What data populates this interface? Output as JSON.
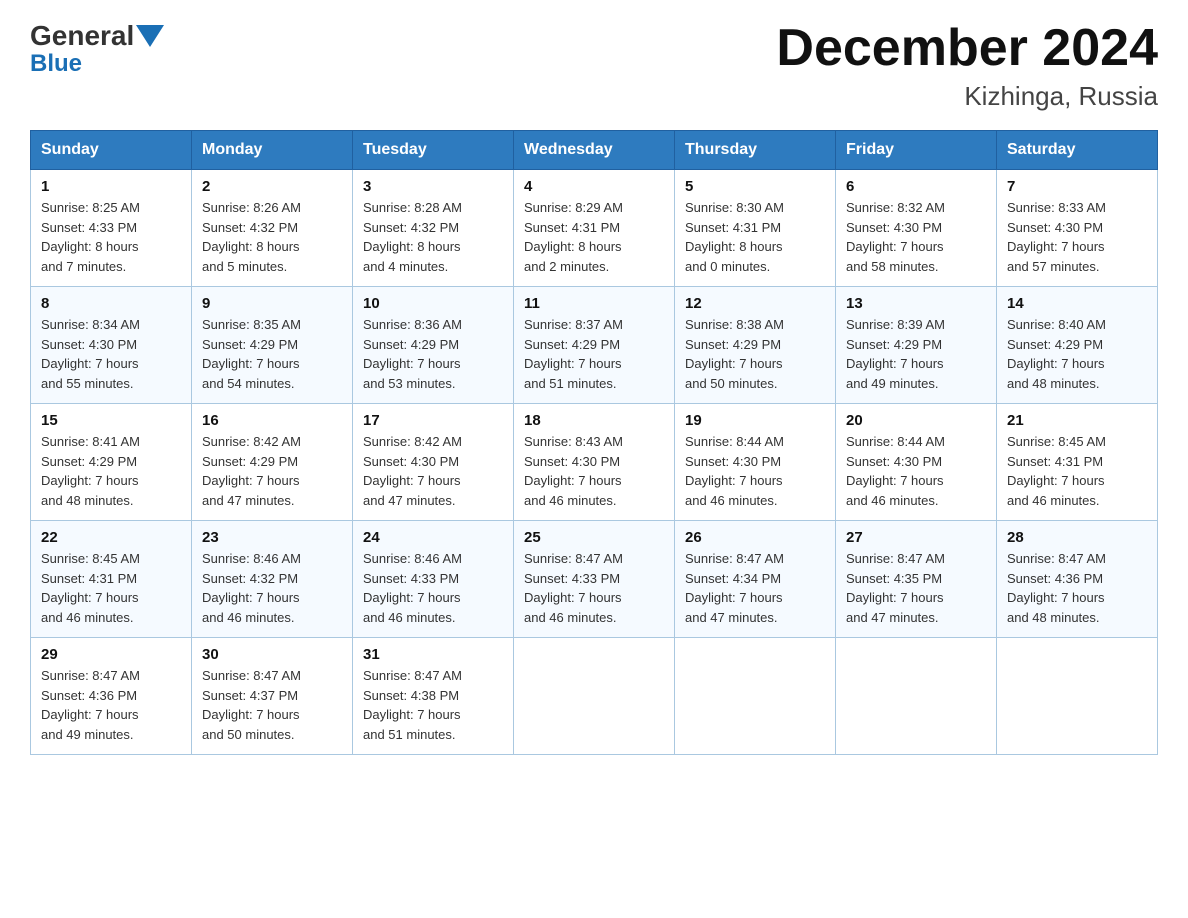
{
  "header": {
    "logo_general": "General",
    "logo_blue": "Blue",
    "title": "December 2024",
    "subtitle": "Kizhinga, Russia"
  },
  "weekdays": [
    "Sunday",
    "Monday",
    "Tuesday",
    "Wednesday",
    "Thursday",
    "Friday",
    "Saturday"
  ],
  "weeks": [
    [
      {
        "day": "1",
        "info": "Sunrise: 8:25 AM\nSunset: 4:33 PM\nDaylight: 8 hours\nand 7 minutes."
      },
      {
        "day": "2",
        "info": "Sunrise: 8:26 AM\nSunset: 4:32 PM\nDaylight: 8 hours\nand 5 minutes."
      },
      {
        "day": "3",
        "info": "Sunrise: 8:28 AM\nSunset: 4:32 PM\nDaylight: 8 hours\nand 4 minutes."
      },
      {
        "day": "4",
        "info": "Sunrise: 8:29 AM\nSunset: 4:31 PM\nDaylight: 8 hours\nand 2 minutes."
      },
      {
        "day": "5",
        "info": "Sunrise: 8:30 AM\nSunset: 4:31 PM\nDaylight: 8 hours\nand 0 minutes."
      },
      {
        "day": "6",
        "info": "Sunrise: 8:32 AM\nSunset: 4:30 PM\nDaylight: 7 hours\nand 58 minutes."
      },
      {
        "day": "7",
        "info": "Sunrise: 8:33 AM\nSunset: 4:30 PM\nDaylight: 7 hours\nand 57 minutes."
      }
    ],
    [
      {
        "day": "8",
        "info": "Sunrise: 8:34 AM\nSunset: 4:30 PM\nDaylight: 7 hours\nand 55 minutes."
      },
      {
        "day": "9",
        "info": "Sunrise: 8:35 AM\nSunset: 4:29 PM\nDaylight: 7 hours\nand 54 minutes."
      },
      {
        "day": "10",
        "info": "Sunrise: 8:36 AM\nSunset: 4:29 PM\nDaylight: 7 hours\nand 53 minutes."
      },
      {
        "day": "11",
        "info": "Sunrise: 8:37 AM\nSunset: 4:29 PM\nDaylight: 7 hours\nand 51 minutes."
      },
      {
        "day": "12",
        "info": "Sunrise: 8:38 AM\nSunset: 4:29 PM\nDaylight: 7 hours\nand 50 minutes."
      },
      {
        "day": "13",
        "info": "Sunrise: 8:39 AM\nSunset: 4:29 PM\nDaylight: 7 hours\nand 49 minutes."
      },
      {
        "day": "14",
        "info": "Sunrise: 8:40 AM\nSunset: 4:29 PM\nDaylight: 7 hours\nand 48 minutes."
      }
    ],
    [
      {
        "day": "15",
        "info": "Sunrise: 8:41 AM\nSunset: 4:29 PM\nDaylight: 7 hours\nand 48 minutes."
      },
      {
        "day": "16",
        "info": "Sunrise: 8:42 AM\nSunset: 4:29 PM\nDaylight: 7 hours\nand 47 minutes."
      },
      {
        "day": "17",
        "info": "Sunrise: 8:42 AM\nSunset: 4:30 PM\nDaylight: 7 hours\nand 47 minutes."
      },
      {
        "day": "18",
        "info": "Sunrise: 8:43 AM\nSunset: 4:30 PM\nDaylight: 7 hours\nand 46 minutes."
      },
      {
        "day": "19",
        "info": "Sunrise: 8:44 AM\nSunset: 4:30 PM\nDaylight: 7 hours\nand 46 minutes."
      },
      {
        "day": "20",
        "info": "Sunrise: 8:44 AM\nSunset: 4:30 PM\nDaylight: 7 hours\nand 46 minutes."
      },
      {
        "day": "21",
        "info": "Sunrise: 8:45 AM\nSunset: 4:31 PM\nDaylight: 7 hours\nand 46 minutes."
      }
    ],
    [
      {
        "day": "22",
        "info": "Sunrise: 8:45 AM\nSunset: 4:31 PM\nDaylight: 7 hours\nand 46 minutes."
      },
      {
        "day": "23",
        "info": "Sunrise: 8:46 AM\nSunset: 4:32 PM\nDaylight: 7 hours\nand 46 minutes."
      },
      {
        "day": "24",
        "info": "Sunrise: 8:46 AM\nSunset: 4:33 PM\nDaylight: 7 hours\nand 46 minutes."
      },
      {
        "day": "25",
        "info": "Sunrise: 8:47 AM\nSunset: 4:33 PM\nDaylight: 7 hours\nand 46 minutes."
      },
      {
        "day": "26",
        "info": "Sunrise: 8:47 AM\nSunset: 4:34 PM\nDaylight: 7 hours\nand 47 minutes."
      },
      {
        "day": "27",
        "info": "Sunrise: 8:47 AM\nSunset: 4:35 PM\nDaylight: 7 hours\nand 47 minutes."
      },
      {
        "day": "28",
        "info": "Sunrise: 8:47 AM\nSunset: 4:36 PM\nDaylight: 7 hours\nand 48 minutes."
      }
    ],
    [
      {
        "day": "29",
        "info": "Sunrise: 8:47 AM\nSunset: 4:36 PM\nDaylight: 7 hours\nand 49 minutes."
      },
      {
        "day": "30",
        "info": "Sunrise: 8:47 AM\nSunset: 4:37 PM\nDaylight: 7 hours\nand 50 minutes."
      },
      {
        "day": "31",
        "info": "Sunrise: 8:47 AM\nSunset: 4:38 PM\nDaylight: 7 hours\nand 51 minutes."
      },
      {
        "day": "",
        "info": ""
      },
      {
        "day": "",
        "info": ""
      },
      {
        "day": "",
        "info": ""
      },
      {
        "day": "",
        "info": ""
      }
    ]
  ]
}
